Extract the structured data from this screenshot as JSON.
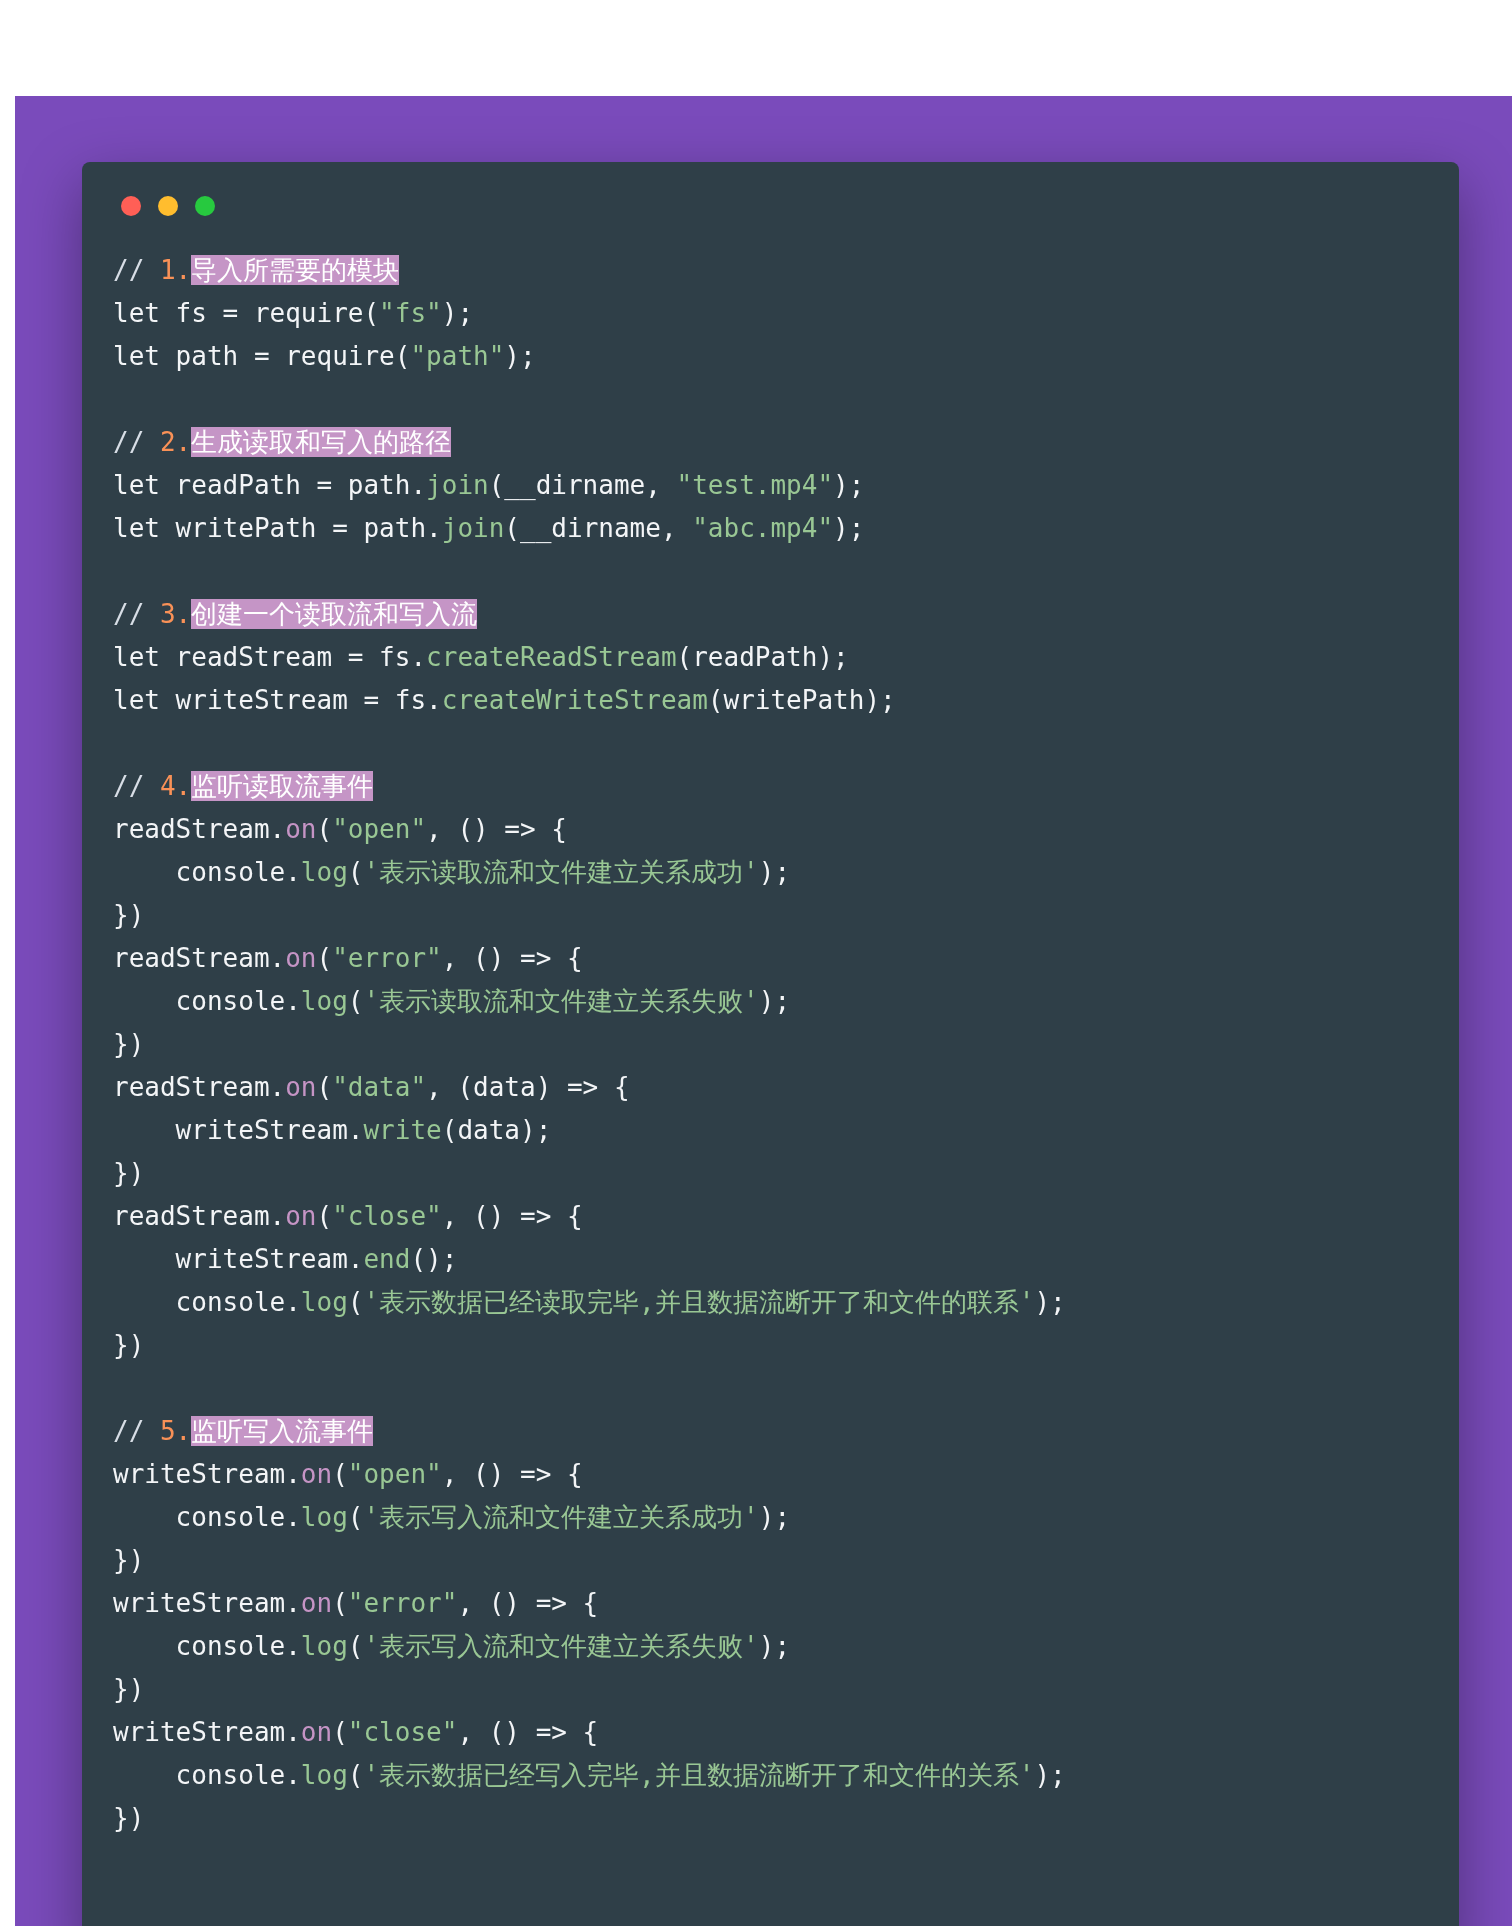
{
  "window_controls": [
    {
      "color": "#ff5f56"
    },
    {
      "color": "#ffbd2e"
    },
    {
      "color": "#27c93f"
    }
  ],
  "code_blocks": [
    {
      "lines": [
        [
          {
            "kind": "comment",
            "text": "// "
          },
          {
            "kind": "number",
            "text": "1."
          },
          {
            "kind": "highlight",
            "text": "导入所需要的模块"
          }
        ],
        [
          {
            "kind": "plain",
            "text": "let fs = require("
          },
          {
            "kind": "string",
            "text": "\"fs\""
          },
          {
            "kind": "plain",
            "text": ");"
          }
        ],
        [
          {
            "kind": "plain",
            "text": "let path = require("
          },
          {
            "kind": "string",
            "text": "\"path\""
          },
          {
            "kind": "plain",
            "text": ");"
          }
        ]
      ]
    },
    {
      "lines": [
        [
          {
            "kind": "comment",
            "text": "// "
          },
          {
            "kind": "number",
            "text": "2."
          },
          {
            "kind": "highlight",
            "text": "生成读取和写入的路径"
          }
        ],
        [
          {
            "kind": "plain",
            "text": "let readPath = path."
          },
          {
            "kind": "function",
            "text": "join"
          },
          {
            "kind": "plain",
            "text": "(__dirname, "
          },
          {
            "kind": "string",
            "text": "\"test.mp4\""
          },
          {
            "kind": "plain",
            "text": ");"
          }
        ],
        [
          {
            "kind": "plain",
            "text": "let writePath = path."
          },
          {
            "kind": "function",
            "text": "join"
          },
          {
            "kind": "plain",
            "text": "(__dirname, "
          },
          {
            "kind": "string",
            "text": "\"abc.mp4\""
          },
          {
            "kind": "plain",
            "text": ");"
          }
        ]
      ]
    },
    {
      "lines": [
        [
          {
            "kind": "comment",
            "text": "// "
          },
          {
            "kind": "number",
            "text": "3."
          },
          {
            "kind": "highlight",
            "text": "创建一个读取流和写入流"
          }
        ],
        [
          {
            "kind": "plain",
            "text": "let readStream = fs."
          },
          {
            "kind": "function",
            "text": "createReadStream"
          },
          {
            "kind": "plain",
            "text": "(readPath);"
          }
        ],
        [
          {
            "kind": "plain",
            "text": "let writeStream = fs."
          },
          {
            "kind": "function",
            "text": "createWriteStream"
          },
          {
            "kind": "plain",
            "text": "(writePath);"
          }
        ]
      ]
    },
    {
      "lines": [
        [
          {
            "kind": "comment",
            "text": "// "
          },
          {
            "kind": "number",
            "text": "4."
          },
          {
            "kind": "highlight",
            "text": "监听读取流事件"
          }
        ],
        [
          {
            "kind": "plain",
            "text": "readStream."
          },
          {
            "kind": "keyword",
            "text": "on"
          },
          {
            "kind": "plain",
            "text": "("
          },
          {
            "kind": "string",
            "text": "\"open\""
          },
          {
            "kind": "plain",
            "text": ", () => {"
          }
        ],
        [
          {
            "kind": "plain",
            "text": "    console."
          },
          {
            "kind": "function",
            "text": "log"
          },
          {
            "kind": "plain",
            "text": "("
          },
          {
            "kind": "string",
            "text": "'表示读取流和文件建立关系成功'"
          },
          {
            "kind": "plain",
            "text": ");"
          }
        ],
        [
          {
            "kind": "plain",
            "text": "})"
          }
        ],
        [
          {
            "kind": "plain",
            "text": "readStream."
          },
          {
            "kind": "keyword",
            "text": "on"
          },
          {
            "kind": "plain",
            "text": "("
          },
          {
            "kind": "string",
            "text": "\"error\""
          },
          {
            "kind": "plain",
            "text": ", () => {"
          }
        ],
        [
          {
            "kind": "plain",
            "text": "    console."
          },
          {
            "kind": "function",
            "text": "log"
          },
          {
            "kind": "plain",
            "text": "("
          },
          {
            "kind": "string",
            "text": "'表示读取流和文件建立关系失败'"
          },
          {
            "kind": "plain",
            "text": ");"
          }
        ],
        [
          {
            "kind": "plain",
            "text": "})"
          }
        ],
        [
          {
            "kind": "plain",
            "text": "readStream."
          },
          {
            "kind": "keyword",
            "text": "on"
          },
          {
            "kind": "plain",
            "text": "("
          },
          {
            "kind": "string",
            "text": "\"data\""
          },
          {
            "kind": "plain",
            "text": ", (data) => {"
          }
        ],
        [
          {
            "kind": "plain",
            "text": "    writeStream."
          },
          {
            "kind": "function",
            "text": "write"
          },
          {
            "kind": "plain",
            "text": "(data);"
          }
        ],
        [
          {
            "kind": "plain",
            "text": "})"
          }
        ],
        [
          {
            "kind": "plain",
            "text": "readStream."
          },
          {
            "kind": "keyword",
            "text": "on"
          },
          {
            "kind": "plain",
            "text": "("
          },
          {
            "kind": "string",
            "text": "\"close\""
          },
          {
            "kind": "plain",
            "text": ", () => {"
          }
        ],
        [
          {
            "kind": "plain",
            "text": "    writeStream."
          },
          {
            "kind": "function",
            "text": "end"
          },
          {
            "kind": "plain",
            "text": "();"
          }
        ],
        [
          {
            "kind": "plain",
            "text": "    console."
          },
          {
            "kind": "function",
            "text": "log"
          },
          {
            "kind": "plain",
            "text": "("
          },
          {
            "kind": "string",
            "text": "'表示数据已经读取完毕,并且数据流断开了和文件的联系'"
          },
          {
            "kind": "plain",
            "text": ");"
          }
        ],
        [
          {
            "kind": "plain",
            "text": "})"
          }
        ]
      ]
    },
    {
      "lines": [
        [
          {
            "kind": "comment",
            "text": "// "
          },
          {
            "kind": "number",
            "text": "5."
          },
          {
            "kind": "highlight",
            "text": "监听写入流事件"
          }
        ],
        [
          {
            "kind": "plain",
            "text": "writeStream."
          },
          {
            "kind": "keyword",
            "text": "on"
          },
          {
            "kind": "plain",
            "text": "("
          },
          {
            "kind": "string",
            "text": "\"open\""
          },
          {
            "kind": "plain",
            "text": ", () => {"
          }
        ],
        [
          {
            "kind": "plain",
            "text": "    console."
          },
          {
            "kind": "function",
            "text": "log"
          },
          {
            "kind": "plain",
            "text": "("
          },
          {
            "kind": "string",
            "text": "'表示写入流和文件建立关系成功'"
          },
          {
            "kind": "plain",
            "text": ");"
          }
        ],
        [
          {
            "kind": "plain",
            "text": "})"
          }
        ],
        [
          {
            "kind": "plain",
            "text": "writeStream."
          },
          {
            "kind": "keyword",
            "text": "on"
          },
          {
            "kind": "plain",
            "text": "("
          },
          {
            "kind": "string",
            "text": "\"error\""
          },
          {
            "kind": "plain",
            "text": ", () => {"
          }
        ],
        [
          {
            "kind": "plain",
            "text": "    console."
          },
          {
            "kind": "function",
            "text": "log"
          },
          {
            "kind": "plain",
            "text": "("
          },
          {
            "kind": "string",
            "text": "'表示写入流和文件建立关系失败'"
          },
          {
            "kind": "plain",
            "text": ");"
          }
        ],
        [
          {
            "kind": "plain",
            "text": "})"
          }
        ],
        [
          {
            "kind": "plain",
            "text": "writeStream."
          },
          {
            "kind": "keyword",
            "text": "on"
          },
          {
            "kind": "plain",
            "text": "("
          },
          {
            "kind": "string",
            "text": "\"close\""
          },
          {
            "kind": "plain",
            "text": ", () => {"
          }
        ],
        [
          {
            "kind": "plain",
            "text": "    console."
          },
          {
            "kind": "function",
            "text": "log"
          },
          {
            "kind": "plain",
            "text": "("
          },
          {
            "kind": "string",
            "text": "'表示数据已经写入完毕,并且数据流断开了和文件的关系'"
          },
          {
            "kind": "plain",
            "text": ");"
          }
        ],
        [
          {
            "kind": "plain",
            "text": "})"
          }
        ]
      ]
    }
  ]
}
